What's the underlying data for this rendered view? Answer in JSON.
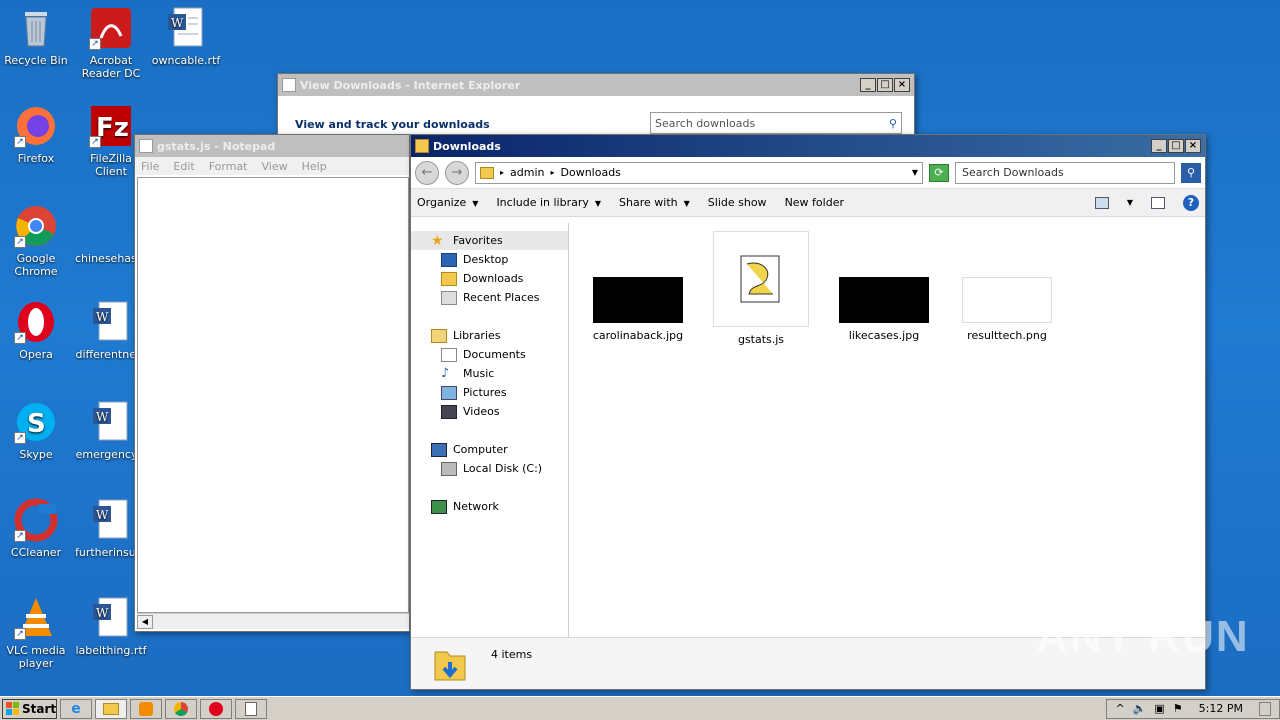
{
  "desktop": {
    "icons": [
      {
        "label": "Recycle Bin"
      },
      {
        "label": "Acrobat Reader DC"
      },
      {
        "label": "owncable.rtf"
      },
      {
        "label": "Firefox"
      },
      {
        "label": "FileZilla Client"
      },
      {
        "label": "Google Chrome"
      },
      {
        "label": "chinesehas..."
      },
      {
        "label": "Opera"
      },
      {
        "label": "differentne..."
      },
      {
        "label": "Skype"
      },
      {
        "label": "emergency..."
      },
      {
        "label": "CCleaner"
      },
      {
        "label": "furtherinsur..."
      },
      {
        "label": "VLC media player"
      },
      {
        "label": "labelthing.rtf"
      }
    ]
  },
  "ie_window": {
    "title": "View Downloads - Internet Explorer",
    "heading": "View and track your downloads",
    "search_placeholder": "Search downloads"
  },
  "notepad": {
    "title": "gstats.js - Notepad",
    "menu": [
      "File",
      "Edit",
      "Format",
      "View",
      "Help"
    ]
  },
  "explorer": {
    "title": "Downloads",
    "breadcrumb": [
      "admin",
      "Downloads"
    ],
    "search_placeholder": "Search Downloads",
    "commands": [
      "Organize",
      "Include in library",
      "Share with",
      "Slide show",
      "New folder"
    ],
    "nav": {
      "favorites": {
        "label": "Favorites",
        "items": [
          "Desktop",
          "Downloads",
          "Recent Places"
        ]
      },
      "libraries": {
        "label": "Libraries",
        "items": [
          "Documents",
          "Music",
          "Pictures",
          "Videos"
        ]
      },
      "computer": {
        "label": "Computer",
        "items": [
          "Local Disk (C:)"
        ]
      },
      "network": {
        "label": "Network"
      }
    },
    "files": [
      {
        "name": "carolinaback.jpg"
      },
      {
        "name": "gstats.js"
      },
      {
        "name": "likecases.jpg"
      },
      {
        "name": "resulttech.png"
      }
    ],
    "item_count": "4 items"
  },
  "taskbar": {
    "start_label": "Start",
    "clock": "5:12 PM"
  },
  "watermark": "ANY RUN"
}
